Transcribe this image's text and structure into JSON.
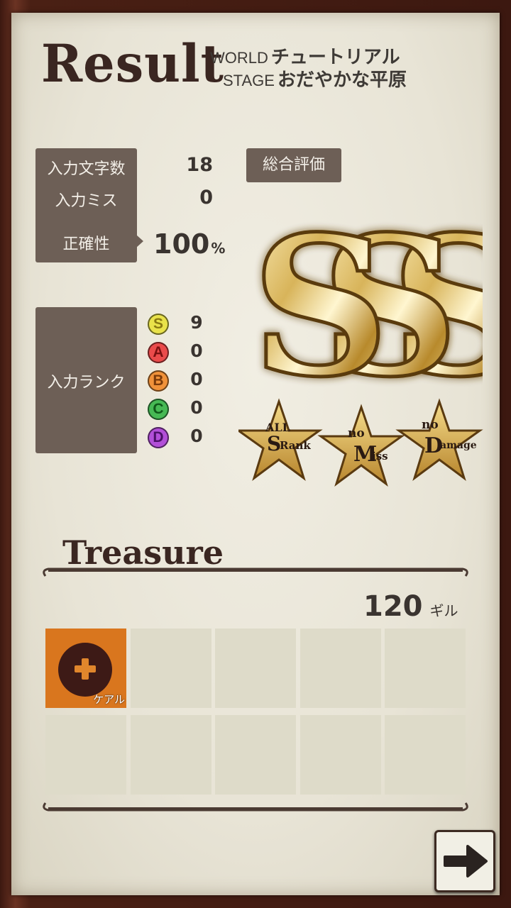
{
  "header": {
    "title": "Result",
    "world_label": "WORLD",
    "world_name": "チュートリアル",
    "stage_label": "STAGE",
    "stage_name": "おだやかな平原"
  },
  "stats": {
    "char_count_label": "入力文字数",
    "char_count_value": "18",
    "miss_label": "入力ミス",
    "miss_value": "0",
    "accuracy_label": "正確性",
    "accuracy_value": "100",
    "accuracy_unit": "%"
  },
  "input_rank": {
    "label": "入力ランク",
    "ranks": [
      {
        "letter": "S",
        "count": "9",
        "color": "#e9e24a",
        "text": "#8a7a12"
      },
      {
        "letter": "A",
        "count": "0",
        "color": "#ea4b4b",
        "text": "#7a1010"
      },
      {
        "letter": "B",
        "count": "0",
        "color": "#f0923a",
        "text": "#7a3a0a"
      },
      {
        "letter": "C",
        "count": "0",
        "color": "#46b954",
        "text": "#0f5a1a"
      },
      {
        "letter": "D",
        "count": "0",
        "color": "#b24fd8",
        "text": "#4a1068"
      }
    ]
  },
  "overall": {
    "label": "総合評価",
    "grade": "SSS",
    "badges": [
      {
        "line1": "ALL",
        "line2": "Rank",
        "cap": "S"
      },
      {
        "line1": "no",
        "line2": "iss",
        "cap": "M"
      },
      {
        "line1": "no",
        "line2": "amage",
        "cap": "D"
      }
    ]
  },
  "treasure": {
    "title": "Treasure",
    "gold_amount": "120",
    "gold_unit": "ギル",
    "items": [
      {
        "name": "ケアル",
        "icon": "plus-icon"
      }
    ]
  },
  "controls": {
    "next_icon": "arrow-right-icon"
  },
  "colors": {
    "panel": "#6d5f56",
    "paper": "#ebe7da",
    "frame": "#4a2014",
    "gold": "#d8b85a",
    "item_slot": "#d9761e",
    "empty_slot": "#dedbc9"
  }
}
